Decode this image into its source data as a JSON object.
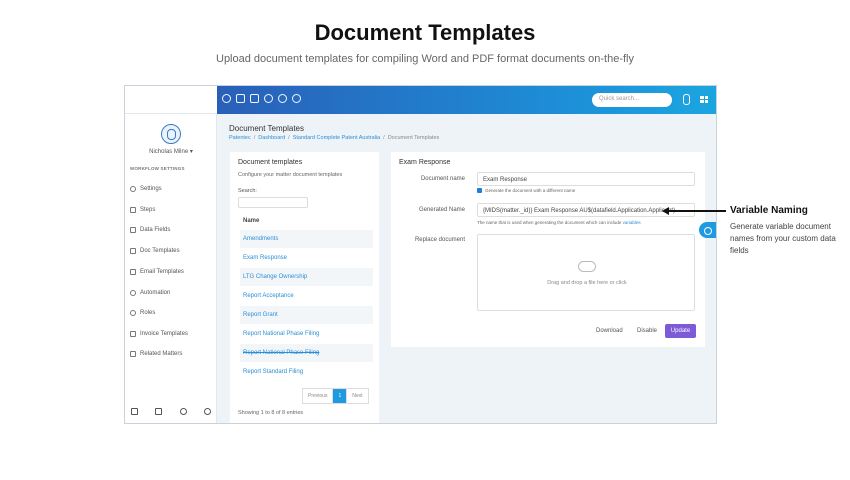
{
  "hero": {
    "title": "Document Templates",
    "subtitle": "Upload document templates for compiling Word and PDF format documents on-the-fly"
  },
  "topbar": {
    "icons": [
      "clock-icon",
      "mail-icon",
      "card-icon",
      "play-icon",
      "timer-icon",
      "user-icon"
    ],
    "search_placeholder": "Quick search...",
    "accent_start": "#2a5fb8",
    "accent_end": "#1ba6e0"
  },
  "sidebar": {
    "user_name": "Nicholas Milne",
    "section_label": "WORKFLOW SETTINGS",
    "items": [
      {
        "label": "Settings",
        "icon": "gear-icon"
      },
      {
        "label": "Steps",
        "icon": "steps-icon"
      },
      {
        "label": "Data Fields",
        "icon": "edit-icon"
      },
      {
        "label": "Doc Templates",
        "icon": "book-icon"
      },
      {
        "label": "Email Templates",
        "icon": "mail-icon"
      },
      {
        "label": "Automation",
        "icon": "automation-icon"
      },
      {
        "label": "Roles",
        "icon": "users-icon"
      },
      {
        "label": "Invoice Templates",
        "icon": "dollar-icon"
      },
      {
        "label": "Related Matters",
        "icon": "map-icon"
      }
    ],
    "bottom_icons": [
      "bank-icon",
      "grid-icon",
      "support-icon",
      "gear-icon"
    ]
  },
  "page": {
    "title": "Document Templates",
    "breadcrumb": [
      "Patentec",
      "Dashboard",
      "Standard Complete Patent Australia",
      "Document Templates"
    ]
  },
  "templates_panel": {
    "title": "Document templates",
    "subtitle": "Configure your matter document templates",
    "search_label": "Search:",
    "column_header": "Name",
    "rows": [
      {
        "name": "Amendments",
        "struck": false
      },
      {
        "name": "Exam Response",
        "struck": false
      },
      {
        "name": "LTG Change Ownership",
        "struck": false
      },
      {
        "name": "Report Acceptance",
        "struck": false
      },
      {
        "name": "Report Grant",
        "struck": false
      },
      {
        "name": "Report National Phase Filing",
        "struck": false
      },
      {
        "name": "Report National Phase Filing",
        "struck": true
      },
      {
        "name": "Report Standard Filing",
        "struck": false
      }
    ],
    "pager": {
      "previous": "Previous",
      "page": "1",
      "next": "Next"
    },
    "showing": "Showing 1 to 8 of 8 entries"
  },
  "editor": {
    "title": "Exam Response",
    "document_name_label": "Document name",
    "document_name_value": "Exam Response",
    "checkbox_label": "Generate the document with a different name",
    "generated_name_label": "Generated Name",
    "generated_name_value": "{MIDS(matter._id)} Exam Response AU$(datafield.Application.Applicant)",
    "hint_text": "The name that is used when generating the document which can include",
    "hint_link": "variables",
    "replace_label": "Replace document",
    "dropzone_text": "Drag and drop a file here or click",
    "download_label": "Download",
    "disable_label": "Disable",
    "update_label": "Update",
    "update_color": "#7d5ad6"
  },
  "callout": {
    "title": "Variable Naming",
    "text": "Generate variable document names from your custom data fields"
  }
}
